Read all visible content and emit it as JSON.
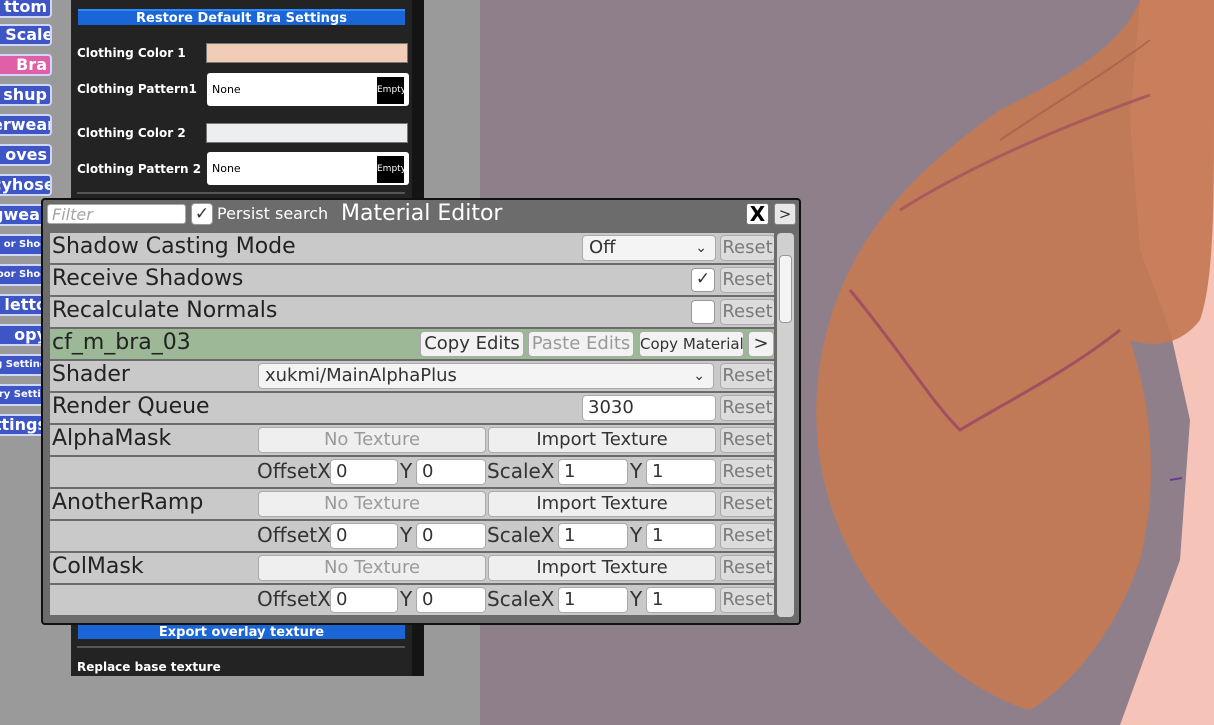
{
  "categories": [
    "ttom",
    "t Scale",
    "Bra",
    "shup",
    "erwear",
    "oves",
    "cyhose",
    "gwear",
    "or Shoe",
    "oor Shoe",
    "letto",
    "opy",
    "g Setting",
    "ory Setting",
    "ttings"
  ],
  "clothing_panel": {
    "restore_label": "Restore Default Bra Settings",
    "color1_label": "Clothing Color 1",
    "color1_value": "#f1cdb8",
    "pattern1_label": "Clothing Pattern1",
    "pattern1_value": "None",
    "color2_label": "Clothing Color 2",
    "color2_value": "#eceef0",
    "pattern2_label": "Clothing Pattern 2",
    "pattern2_value": "None",
    "empty_label": "Empty",
    "export_label": "Export overlay texture",
    "replace_label": "Replace base texture"
  },
  "material_editor": {
    "filter_placeholder": "Filter",
    "persist_search_label": "Persist search",
    "persist_search_checked": true,
    "title": "Material Editor",
    "close_label": "X",
    "more_label": ">",
    "reset_label": "Reset",
    "shadow_casting": {
      "label": "Shadow Casting Mode",
      "value": "Off"
    },
    "receive_shadows": {
      "label": "Receive Shadows",
      "checked": true
    },
    "recalc_normals": {
      "label": "Recalculate Normals",
      "checked": false
    },
    "material": {
      "name": "cf_m_bra_03",
      "copy_edits": "Copy Edits",
      "paste_edits": "Paste Edits",
      "copy_material": "Copy Material",
      "more": ">"
    },
    "shader": {
      "label": "Shader",
      "value": "xukmi/MainAlphaPlus"
    },
    "render_queue": {
      "label": "Render Queue",
      "value": "3030"
    },
    "texture_props": [
      {
        "label": "AlphaMask",
        "no_texture": "No Texture",
        "import": "Import Texture",
        "offset_x_label": "OffsetX",
        "offset_x": "0",
        "y_label": "Y",
        "offset_y": "0",
        "scale_x_label": "ScaleX",
        "scale_x": "1",
        "scale_y_label": "Y",
        "scale_y": "1"
      },
      {
        "label": "AnotherRamp",
        "no_texture": "No Texture",
        "import": "Import Texture",
        "offset_x_label": "OffsetX",
        "offset_x": "0",
        "y_label": "Y",
        "offset_y": "0",
        "scale_x_label": "ScaleX",
        "scale_x": "1",
        "scale_y_label": "Y",
        "scale_y": "1"
      },
      {
        "label": "ColMask",
        "no_texture": "No Texture",
        "import": "Import Texture",
        "offset_x_label": "OffsetX",
        "offset_x": "0",
        "y_label": "Y",
        "offset_y": "0",
        "scale_x_label": "ScaleX",
        "scale_x": "1",
        "scale_y_label": "Y",
        "scale_y": "1"
      }
    ]
  }
}
